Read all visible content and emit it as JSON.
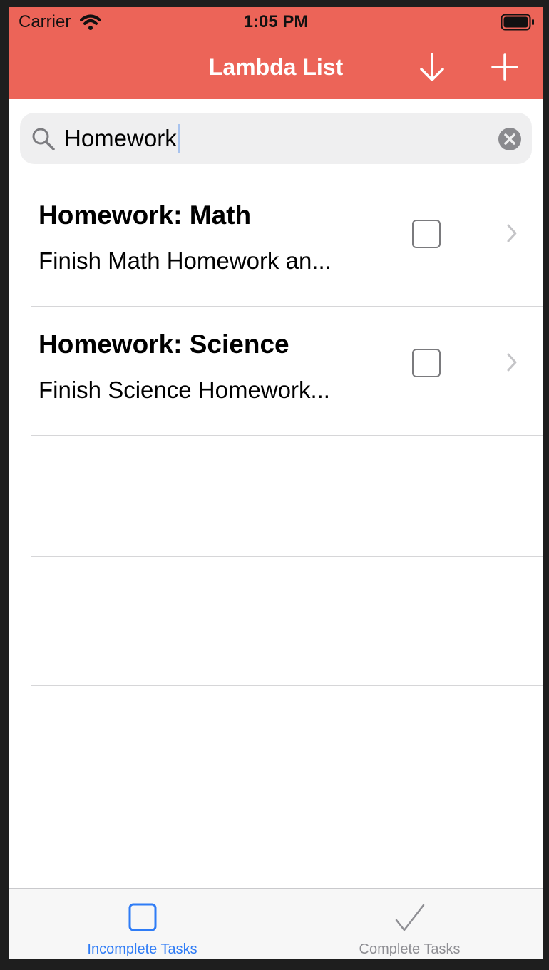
{
  "status_bar": {
    "carrier": "Carrier",
    "time": "1:05 PM"
  },
  "nav": {
    "title": "Lambda List",
    "sort_icon": "arrow-down-icon",
    "add_icon": "plus-icon"
  },
  "search": {
    "value": "Homework",
    "icon": "magnifier-icon",
    "clear_icon": "clear-circle-icon"
  },
  "tasks": [
    {
      "title": "Homework: Math",
      "subtitle": "Finish Math Homework an...",
      "completed": false
    },
    {
      "title": "Homework: Science",
      "subtitle": "Finish Science Homework...",
      "completed": false
    }
  ],
  "tabbar": {
    "tabs": [
      {
        "label": "Incomplete Tasks",
        "icon": "square-icon",
        "selected": true
      },
      {
        "label": "Complete Tasks",
        "icon": "checkmark-icon",
        "selected": false
      }
    ]
  },
  "colors": {
    "header": "#ec6458",
    "tab_active": "#2f7cf6",
    "tab_inactive": "#8e8e93"
  }
}
